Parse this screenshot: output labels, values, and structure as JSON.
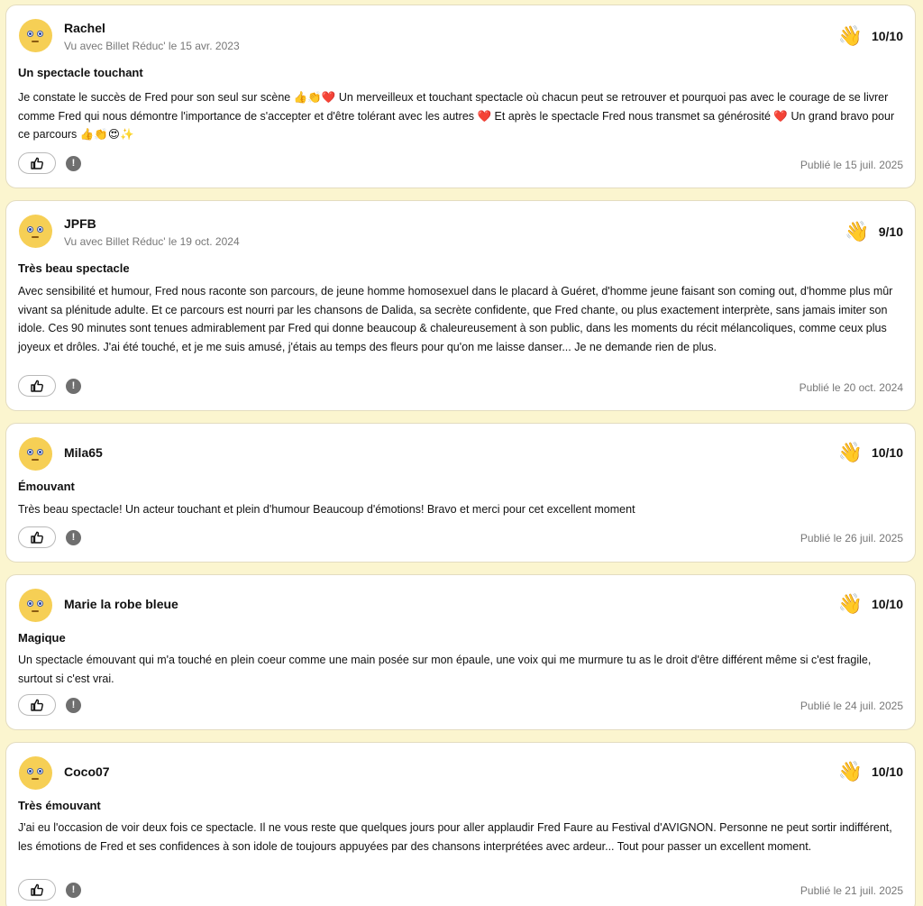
{
  "reviews": [
    {
      "name": "Rachel",
      "seen": "Vu avec Billet Réduc' le 15 avr. 2023",
      "score": "10/10",
      "title": "Un spectacle touchant",
      "body": "Je constate le succès de Fred pour son seul sur scène 👍👏❤️ Un merveilleux et touchant spectacle où chacun peut se retrouver et pourquoi pas avec le courage de se livrer comme Fred qui nous démontre l'importance de s'accepter et d'être tolérant avec les autres ❤️ Et après le spectacle Fred nous transmet sa générosité ❤️ Un grand bravo pour ce parcours 👍👏😍✨",
      "published": "Publié le 15 juil. 2025"
    },
    {
      "name": "JPFB",
      "seen": "Vu avec Billet Réduc' le 19 oct. 2024",
      "score": "9/10",
      "title": "Très beau spectacle",
      "body": "Avec sensibilité et humour, Fred nous raconte son parcours, de jeune homme homosexuel dans le placard à Guéret, d'homme jeune faisant son coming out, d'homme plus mûr vivant sa plénitude adulte. Et ce parcours est nourri par les chansons de Dalida, sa secrète confidente, que Fred chante, ou plus exactement interprète, sans jamais imiter son idole. Ces 90 minutes sont tenues admirablement par Fred qui donne beaucoup & chaleureusement à son public, dans les moments du récit mélancoliques, comme ceux plus joyeux et drôles. J'ai été touché, et je me suis amusé, j'étais au temps des fleurs pour qu'on me laisse danser... Je ne demande rien de plus.",
      "published": "Publié le 20 oct. 2024"
    },
    {
      "name": "Mila65",
      "seen": "",
      "score": "10/10",
      "title": "Émouvant",
      "body": "Très beau spectacle! Un acteur touchant et plein d'humour Beaucoup d'émotions! Bravo et merci pour cet excellent moment",
      "published": "Publié le 26 juil. 2025"
    },
    {
      "name": "Marie la robe bleue",
      "seen": "",
      "score": "10/10",
      "title": "Magique",
      "body": "Un spectacle émouvant qui m'a touché en plein coeur comme une main posée sur mon épaule, une voix qui me murmure tu as le droit d'être différent même si c'est fragile, surtout si c'est vrai.",
      "published": "Publié le 24 juil. 2025"
    },
    {
      "name": "Coco07",
      "seen": "",
      "score": "10/10",
      "title": "Très émouvant",
      "body": "J'ai eu l'occasion de voir deux fois ce spectacle. Il ne vous reste que quelques jours pour aller applaudir Fred Faure au Festival d'AVIGNON. Personne ne peut sortir indifférent, les émotions de Fred et ses confidences à son idole de toujours appuyées par des chansons interprétées avec ardeur... Tout pour passer un excellent moment.",
      "published": "Publié le 21 juil. 2025"
    }
  ],
  "icons": {
    "avatar": "smiley-avatar-icon",
    "rating": "waving-hand-icon",
    "like": "thumbs-up-icon",
    "report": "exclamation-icon",
    "report_glyph": "!",
    "rating_glyph": "👋"
  },
  "colors": {
    "page_background": "#fbf5cf",
    "avatar": "#f6cf55",
    "meta_text": "#777777"
  }
}
